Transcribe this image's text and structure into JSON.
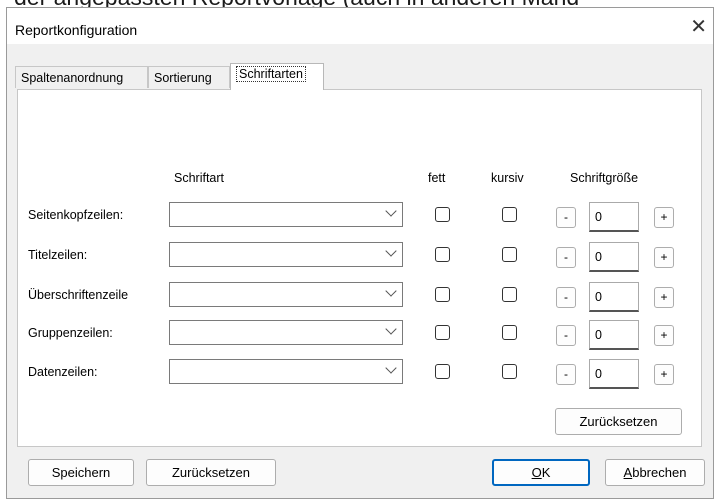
{
  "background": {
    "text": "der angepassten Reportvorlage (auch in anderen Mand"
  },
  "window": {
    "title": "Reportkonfiguration",
    "close_icon": "close-icon"
  },
  "tabs": [
    {
      "label": "Spaltenanordnung"
    },
    {
      "label": "Sortierung"
    },
    {
      "label": "Schriftarten",
      "active": true
    }
  ],
  "columns": {
    "font": "Schriftart",
    "bold": "fett",
    "italic": "kursiv",
    "size": "Schriftgröße"
  },
  "rows": [
    {
      "label": "Seitenkopfzeilen:",
      "font": "",
      "bold": false,
      "italic": false,
      "size": "0"
    },
    {
      "label": "Titelzeilen:",
      "font": "",
      "bold": false,
      "italic": false,
      "size": "0"
    },
    {
      "label": "Überschriftenzeile",
      "font": "",
      "bold": false,
      "italic": false,
      "size": "0"
    },
    {
      "label": "Gruppenzeilen:",
      "font": "",
      "bold": false,
      "italic": false,
      "size": "0"
    },
    {
      "label": "Datenzeilen:",
      "font": "",
      "bold": false,
      "italic": false,
      "size": "0"
    }
  ],
  "size_buttons": {
    "decrease": "-",
    "increase": "+"
  },
  "panel_reset_label": "Zurücksetzen",
  "footer": {
    "save": "Speichern",
    "reset": "Zurücksetzen",
    "ok_mnemonic": "O",
    "ok_rest": "K",
    "cancel_mnemonic": "A",
    "cancel_rest": "bbrechen"
  },
  "colors": {
    "accent": "#0067c0",
    "dialog_bg": "#f0f0f0"
  }
}
